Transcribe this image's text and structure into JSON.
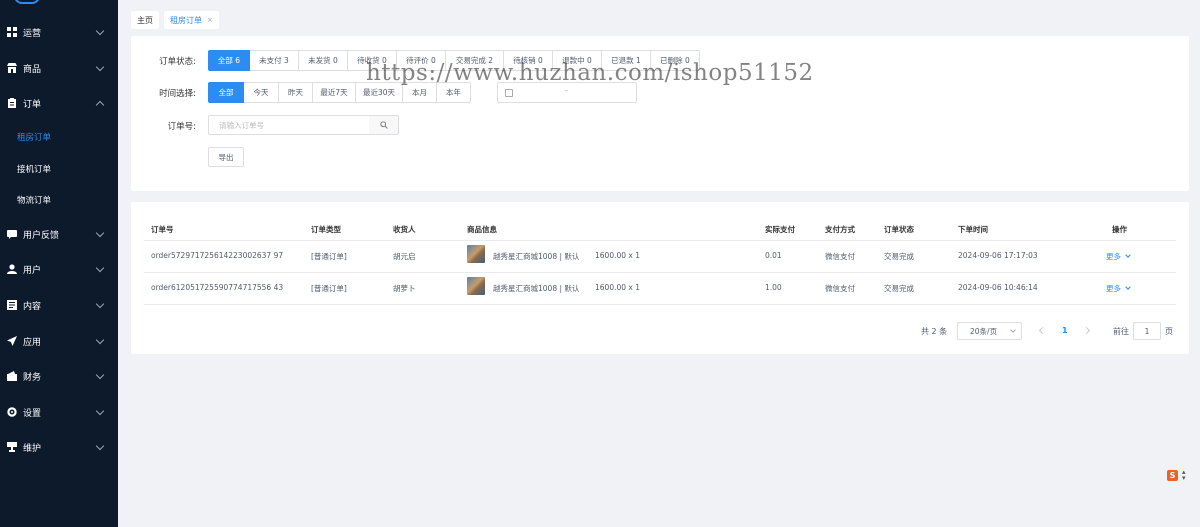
{
  "sidebar": {
    "menu": [
      {
        "label": "运营",
        "icon": "grid-icon",
        "expanded": false
      },
      {
        "label": "商品",
        "icon": "shop-icon",
        "expanded": false
      },
      {
        "label": "订单",
        "icon": "clipboard-icon",
        "expanded": true
      },
      {
        "label": "用户反馈",
        "icon": "chat-icon",
        "expanded": false
      },
      {
        "label": "用户",
        "icon": "user-icon",
        "expanded": false
      },
      {
        "label": "内容",
        "icon": "document-icon",
        "expanded": false
      },
      {
        "label": "应用",
        "icon": "paper-plane-icon",
        "expanded": false
      },
      {
        "label": "财务",
        "icon": "wallet-icon",
        "expanded": false
      },
      {
        "label": "设置",
        "icon": "gear-icon",
        "expanded": false
      },
      {
        "label": "维护",
        "icon": "server-icon",
        "expanded": false
      }
    ],
    "order_submenu": [
      {
        "label": "租房订单",
        "active": true
      },
      {
        "label": "接机订单",
        "active": false
      },
      {
        "label": "物流订单",
        "active": false
      }
    ]
  },
  "tabs": [
    {
      "label": "主页"
    },
    {
      "label": "租房订单",
      "close": "×"
    }
  ],
  "filters": {
    "status_label": "订单状态:",
    "status_options": [
      "全部 6",
      "未支付 3",
      "未发货 0",
      "待收货 0",
      "待评价 0",
      "交易完成 2",
      "待核销 0",
      "退款中 0",
      "已退款 1",
      "已删除 0"
    ],
    "status_selected": 0,
    "time_label": "时间选择:",
    "time_options": [
      "全部",
      "今天",
      "昨天",
      "最近7天",
      "最近30天",
      "本月",
      "本年"
    ],
    "time_selected": 0,
    "date_separator": "-",
    "order_no_label": "订单号:",
    "order_no_placeholder": "请输入订单号",
    "export_label": "导出"
  },
  "table": {
    "headers": [
      "订单号",
      "订单类型",
      "收货人",
      "商品信息",
      "实际支付",
      "支付方式",
      "订单状态",
      "下单时间",
      "操作"
    ],
    "rows": [
      {
        "order_no": "order572971725614223002637 97",
        "type": "[普通订单]",
        "receiver": "胡元启",
        "product": "越秀星汇商城1008 | 默认",
        "price_qty": "1600.00 x 1",
        "paid": "0.01",
        "pay_method": "微信支付",
        "status": "交易完成",
        "time": "2024-09-06 17:17:03",
        "action": "更多"
      },
      {
        "order_no": "order612051725590774717556 43",
        "type": "[普通订单]",
        "receiver": "胡萝卜",
        "product": "越秀星汇商城1008 | 默认",
        "price_qty": "1600.00 x 1",
        "paid": "1.00",
        "pay_method": "微信支付",
        "status": "交易完成",
        "time": "2024-09-06 10:46:14",
        "action": "更多"
      }
    ]
  },
  "pagination": {
    "total": "共 2 条",
    "page_size": "20条/页",
    "current": "1",
    "goto_label": "前往",
    "goto_value": "1",
    "page_unit": "页"
  },
  "watermark": "https://www.huzhan.com/ishop51152",
  "colors": {
    "accent": "#2d8cf0",
    "sidebar": "#0c1a2c",
    "corner_badge": "#e8622a"
  }
}
